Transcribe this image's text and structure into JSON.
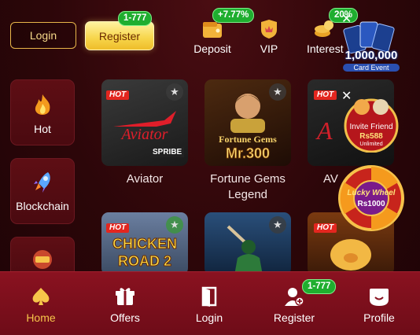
{
  "header": {
    "login_label": "Login",
    "register_label": "Register",
    "register_badge": "1-777",
    "deposit": {
      "label": "Deposit",
      "badge": "+7.77%"
    },
    "vip": {
      "label": "VIP"
    },
    "interest": {
      "label": "Interest",
      "badge": "20%"
    }
  },
  "sidebar": {
    "items": [
      {
        "label": "Hot",
        "icon": "flame-icon"
      },
      {
        "label": "Blockchain",
        "icon": "rocket-icon"
      },
      {
        "label": "",
        "icon": "lottery-icon"
      }
    ]
  },
  "games": [
    {
      "name": "Aviator",
      "tag": "HOT",
      "brand": "SPRIBE"
    },
    {
      "name": "Fortune Gems Legend",
      "art_text": "Fortune Gems Mr.300"
    },
    {
      "name": "AV",
      "tag": "HOT"
    },
    {
      "name": "",
      "tag": "HOT",
      "art_text": "CHICKEN ROAD 2"
    },
    {
      "name": ""
    },
    {
      "name": "",
      "tag": "HOT"
    }
  ],
  "promos": {
    "card_event": {
      "amount": "1,000,000",
      "subtitle": "Card Event"
    },
    "invite": {
      "title": "Invite Friend",
      "amount": "Rs588",
      "note": "Unlimited"
    },
    "wheel": {
      "title": "Lucky Wheel",
      "amount": "Rs1000"
    }
  },
  "bottom_nav": {
    "items": [
      {
        "label": "Home",
        "active": true
      },
      {
        "label": "Offers"
      },
      {
        "label": "Login"
      },
      {
        "label": "Register",
        "badge": "1-777"
      },
      {
        "label": "Profile"
      }
    ]
  },
  "colors": {
    "accent": "#f7c64a",
    "badge": "#1fae2f",
    "bar": "#8a1220"
  }
}
